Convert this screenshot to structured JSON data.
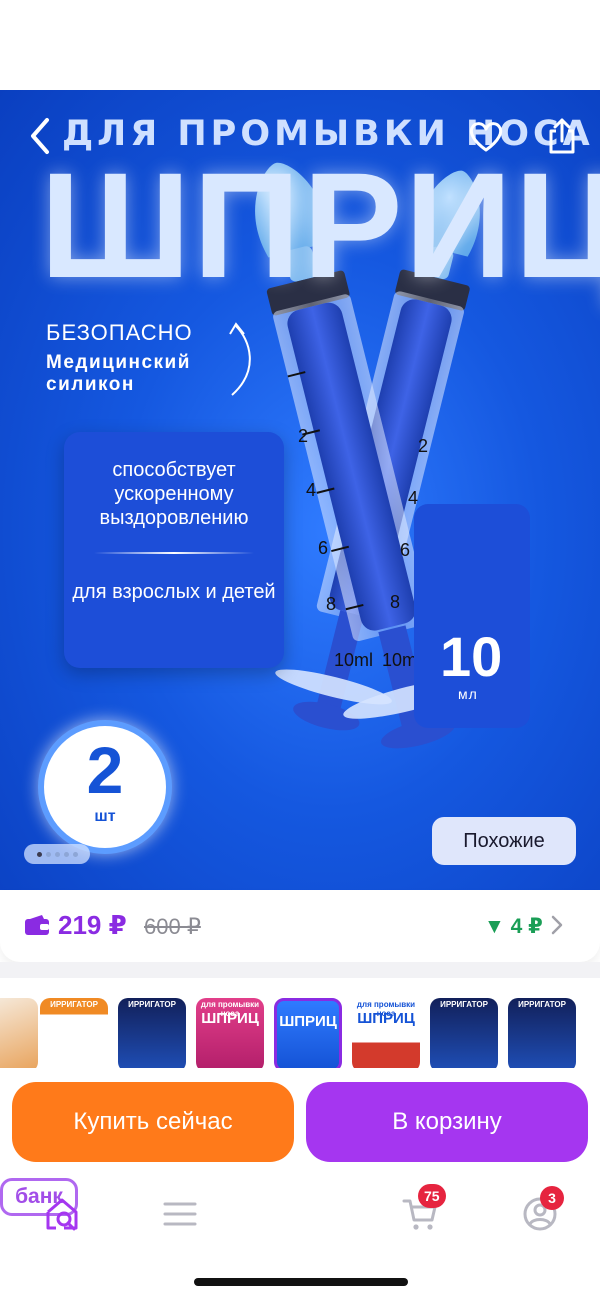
{
  "hero": {
    "subtitle": "ДЛЯ ПРОМЫВКИ НОСА",
    "title": "ШПРИЦ",
    "safe_label": "БЕЗОПАСНО",
    "silicone_label": "Медицинский силикон",
    "promo_line1": "способствует ускоренному выздоровлению",
    "promo_line2": "для взрослых и детей",
    "syringe_marks": [
      "2",
      "4",
      "6",
      "8",
      "10ml"
    ],
    "volume_number": "10",
    "volume_unit": "мл",
    "count_number": "2",
    "count_unit": "шт",
    "image_index": 1,
    "image_total": 5
  },
  "top_bar": {
    "back_icon": "chevron-left-icon",
    "favorite_icon": "heart-icon",
    "share_icon": "share-icon"
  },
  "similar_label": "Похожие",
  "price": {
    "current": "219 ₽",
    "old": "600 ₽",
    "cashback": "▼ 4 ₽"
  },
  "thumbnails": [
    {
      "title": "",
      "big": ""
    },
    {
      "title": "ИРРИГАТОР",
      "big": ""
    },
    {
      "title": "ИРРИГАТОР",
      "big": ""
    },
    {
      "title": "для промывки носа",
      "big": "ШПРИЦ"
    },
    {
      "title": "",
      "big": "ШПРИЦ"
    },
    {
      "title": "для промывки носа",
      "big": "ШПРИЦ"
    },
    {
      "title": "ИРРИГАТОР",
      "big": ""
    },
    {
      "title": "ИРРИГАТОР",
      "big": ""
    }
  ],
  "actions": {
    "buy_now": "Купить сейчас",
    "add_to_cart": "В корзину"
  },
  "nav": {
    "bank_label": "банк",
    "cart_badge": "75",
    "profile_badge": "3"
  },
  "colors": {
    "accent_purple": "#a536f0",
    "accent_orange": "#ff7a1a",
    "price_purple": "#8a2be2",
    "cashback_green": "#1a9e56",
    "badge_red": "#e6243f"
  }
}
